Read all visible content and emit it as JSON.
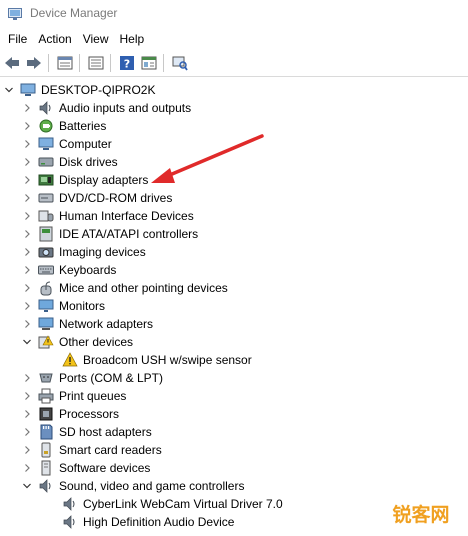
{
  "window": {
    "title": "Device Manager"
  },
  "menu": {
    "file": "File",
    "action": "Action",
    "view": "View",
    "help": "Help"
  },
  "toolbar": {
    "icons": [
      "back-icon",
      "forward-icon",
      "properties-icon",
      "show-hide-icon",
      "help-icon",
      "view-icon",
      "scan-icon"
    ]
  },
  "tree": {
    "root": "DESKTOP-QIPRO2K",
    "items": [
      {
        "label": "Audio inputs and outputs",
        "icon": "speaker-icon"
      },
      {
        "label": "Batteries",
        "icon": "battery-icon"
      },
      {
        "label": "Computer",
        "icon": "computer-icon"
      },
      {
        "label": "Disk drives",
        "icon": "disk-drive-icon"
      },
      {
        "label": "Display adapters",
        "icon": "display-adapter-icon"
      },
      {
        "label": "DVD/CD-ROM drives",
        "icon": "dvd-icon"
      },
      {
        "label": "Human Interface Devices",
        "icon": "hid-icon"
      },
      {
        "label": "IDE ATA/ATAPI controllers",
        "icon": "ide-icon"
      },
      {
        "label": "Imaging devices",
        "icon": "camera-icon"
      },
      {
        "label": "Keyboards",
        "icon": "keyboard-icon"
      },
      {
        "label": "Mice and other pointing devices",
        "icon": "mouse-icon"
      },
      {
        "label": "Monitors",
        "icon": "monitor-icon"
      },
      {
        "label": "Network adapters",
        "icon": "network-icon"
      },
      {
        "label": "Other devices",
        "icon": "other-devices-icon",
        "expanded": true
      },
      {
        "label": "Broadcom USH w/swipe sensor",
        "icon": "warning-device-icon",
        "child": true
      },
      {
        "label": "Ports (COM & LPT)",
        "icon": "port-icon"
      },
      {
        "label": "Print queues",
        "icon": "printer-icon"
      },
      {
        "label": "Processors",
        "icon": "processor-icon"
      },
      {
        "label": "SD host adapters",
        "icon": "sd-card-icon"
      },
      {
        "label": "Smart card readers",
        "icon": "smart-card-icon"
      },
      {
        "label": "Software devices",
        "icon": "software-device-icon"
      },
      {
        "label": "Sound, video and game controllers",
        "icon": "speaker-icon",
        "expanded": true
      },
      {
        "label": "CyberLink WebCam Virtual Driver 7.0",
        "icon": "speaker-icon",
        "child": true
      },
      {
        "label": "High Definition Audio Device",
        "icon": "speaker-icon",
        "child": true
      }
    ]
  },
  "watermark": {
    "text": "锐客网"
  },
  "colors": {
    "annotation_arrow": "#e02a2a",
    "title_text": "#7a7a7a",
    "watermark": "#f0a020"
  }
}
